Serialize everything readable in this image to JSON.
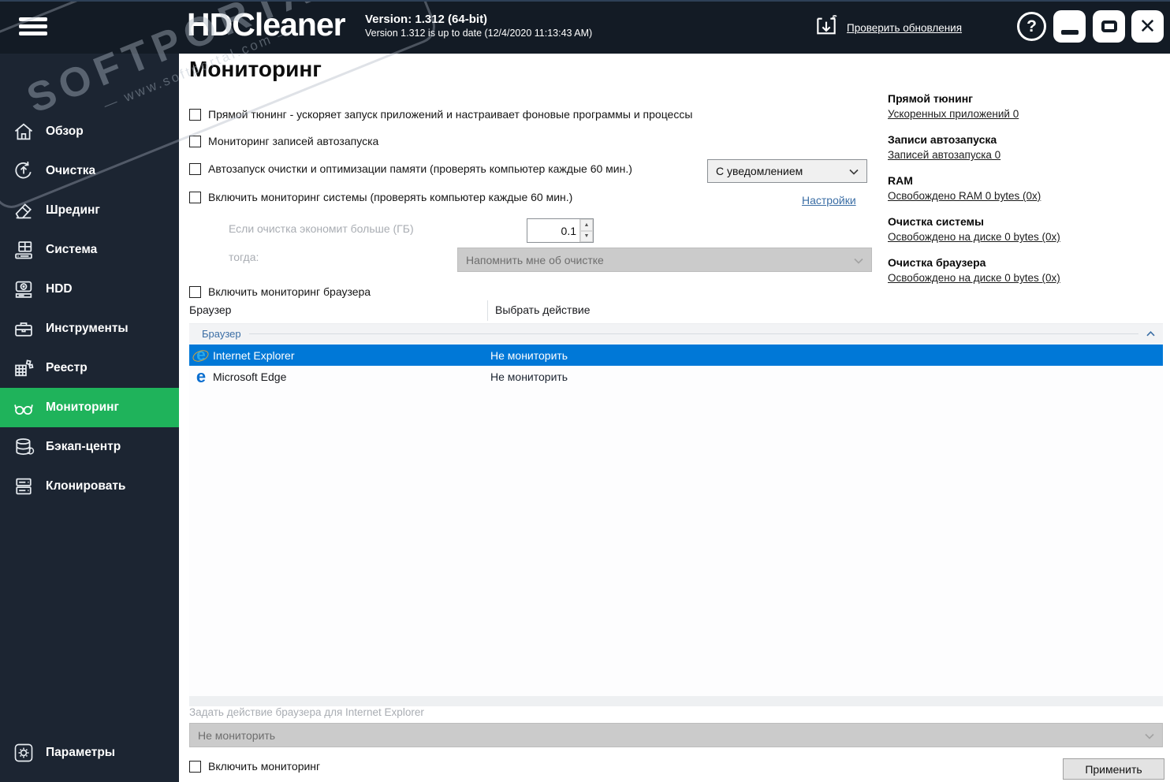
{
  "titlebar": {
    "app_name": "HDCleaner",
    "version_line1": "Version: 1.312 (64-bit)",
    "version_line2": "Version 1.312 is up to date (12/4/2020 11:13:43 AM)",
    "check_updates_link": "Проверить обновления",
    "help_glyph": "?"
  },
  "watermark": {
    "line1": "SOFTPORTAL",
    "line2": "— www.softportal.com —"
  },
  "sidebar": {
    "items": [
      {
        "label": "Обзор",
        "icon": "home-icon"
      },
      {
        "label": "Очистка",
        "icon": "recycle-icon"
      },
      {
        "label": "Шрединг",
        "icon": "eraser-icon"
      },
      {
        "label": "Система",
        "icon": "system-icon"
      },
      {
        "label": "HDD",
        "icon": "hdd-icon"
      },
      {
        "label": "Инструменты",
        "icon": "toolbox-icon"
      },
      {
        "label": "Реестр",
        "icon": "registry-icon"
      },
      {
        "label": "Мониторинг",
        "icon": "glasses-icon",
        "active": true
      },
      {
        "label": "Бэкап-центр",
        "icon": "backup-icon"
      },
      {
        "label": "Клонировать",
        "icon": "clone-icon"
      },
      {
        "label": "Параметры",
        "icon": "gear-icon"
      }
    ]
  },
  "main": {
    "title": "Мониторинг",
    "checkbox_direct_tuning": "Прямой тюнинг - ускоряет запуск приложений и настраивает фоновые программы и процессы",
    "checkbox_autostart_monitor": "Мониторинг записей автозапуска",
    "checkbox_auto_clean": "Автозапуск очистки и оптимизации памяти (проверять компьютер каждые 60 мин.)",
    "notify_dropdown_value": "С уведомлением",
    "checkbox_system_monitor": "Включить мониторинг системы (проверять компьютер каждые 60 мин.)",
    "settings_link": "Настройки",
    "threshold_label": "Если очистка экономит больше (ГБ)",
    "threshold_value": "0.1",
    "then_label": "тогда:",
    "remind_dropdown_value": "Напомнить мне об очистке",
    "checkbox_browser_monitor": "Включить мониторинг браузера",
    "table": {
      "col_browser": "Браузер",
      "col_action": "Выбрать действие",
      "group_label": "Браузер",
      "rows": [
        {
          "name": "Internet Explorer",
          "action": "Не мониторить",
          "icon": "internet-explorer-icon",
          "selected": true
        },
        {
          "name": "Microsoft Edge",
          "action": "Не мониторить",
          "icon": "microsoft-edge-icon",
          "selected": false
        }
      ]
    },
    "footer": {
      "action_label": "Задать действие браузера для Internet Explorer",
      "action_dropdown_value": "Не мониторить",
      "enable_checkbox": "Включить мониторинг",
      "apply_button": "Применить"
    }
  },
  "stats": [
    {
      "title": "Прямой тюнинг",
      "link": "Ускоренных приложений 0"
    },
    {
      "title": "Записи автозапуска",
      "link": "Записей автозапуска 0"
    },
    {
      "title": "RAM",
      "link": "Освобождено RAM 0 bytes (0x)"
    },
    {
      "title": "Очистка системы",
      "link": "Освобождено на диске 0 bytes (0x)"
    },
    {
      "title": "Очистка браузера",
      "link": "Освобождено на диске 0 bytes (0x)"
    }
  ],
  "colors": {
    "titlebar_bg": "#131b25",
    "sidebar_bg": "#1c2532",
    "active_green": "#1fb35b",
    "selection_blue": "#0078d7",
    "link_blue": "#3b6ea5"
  }
}
